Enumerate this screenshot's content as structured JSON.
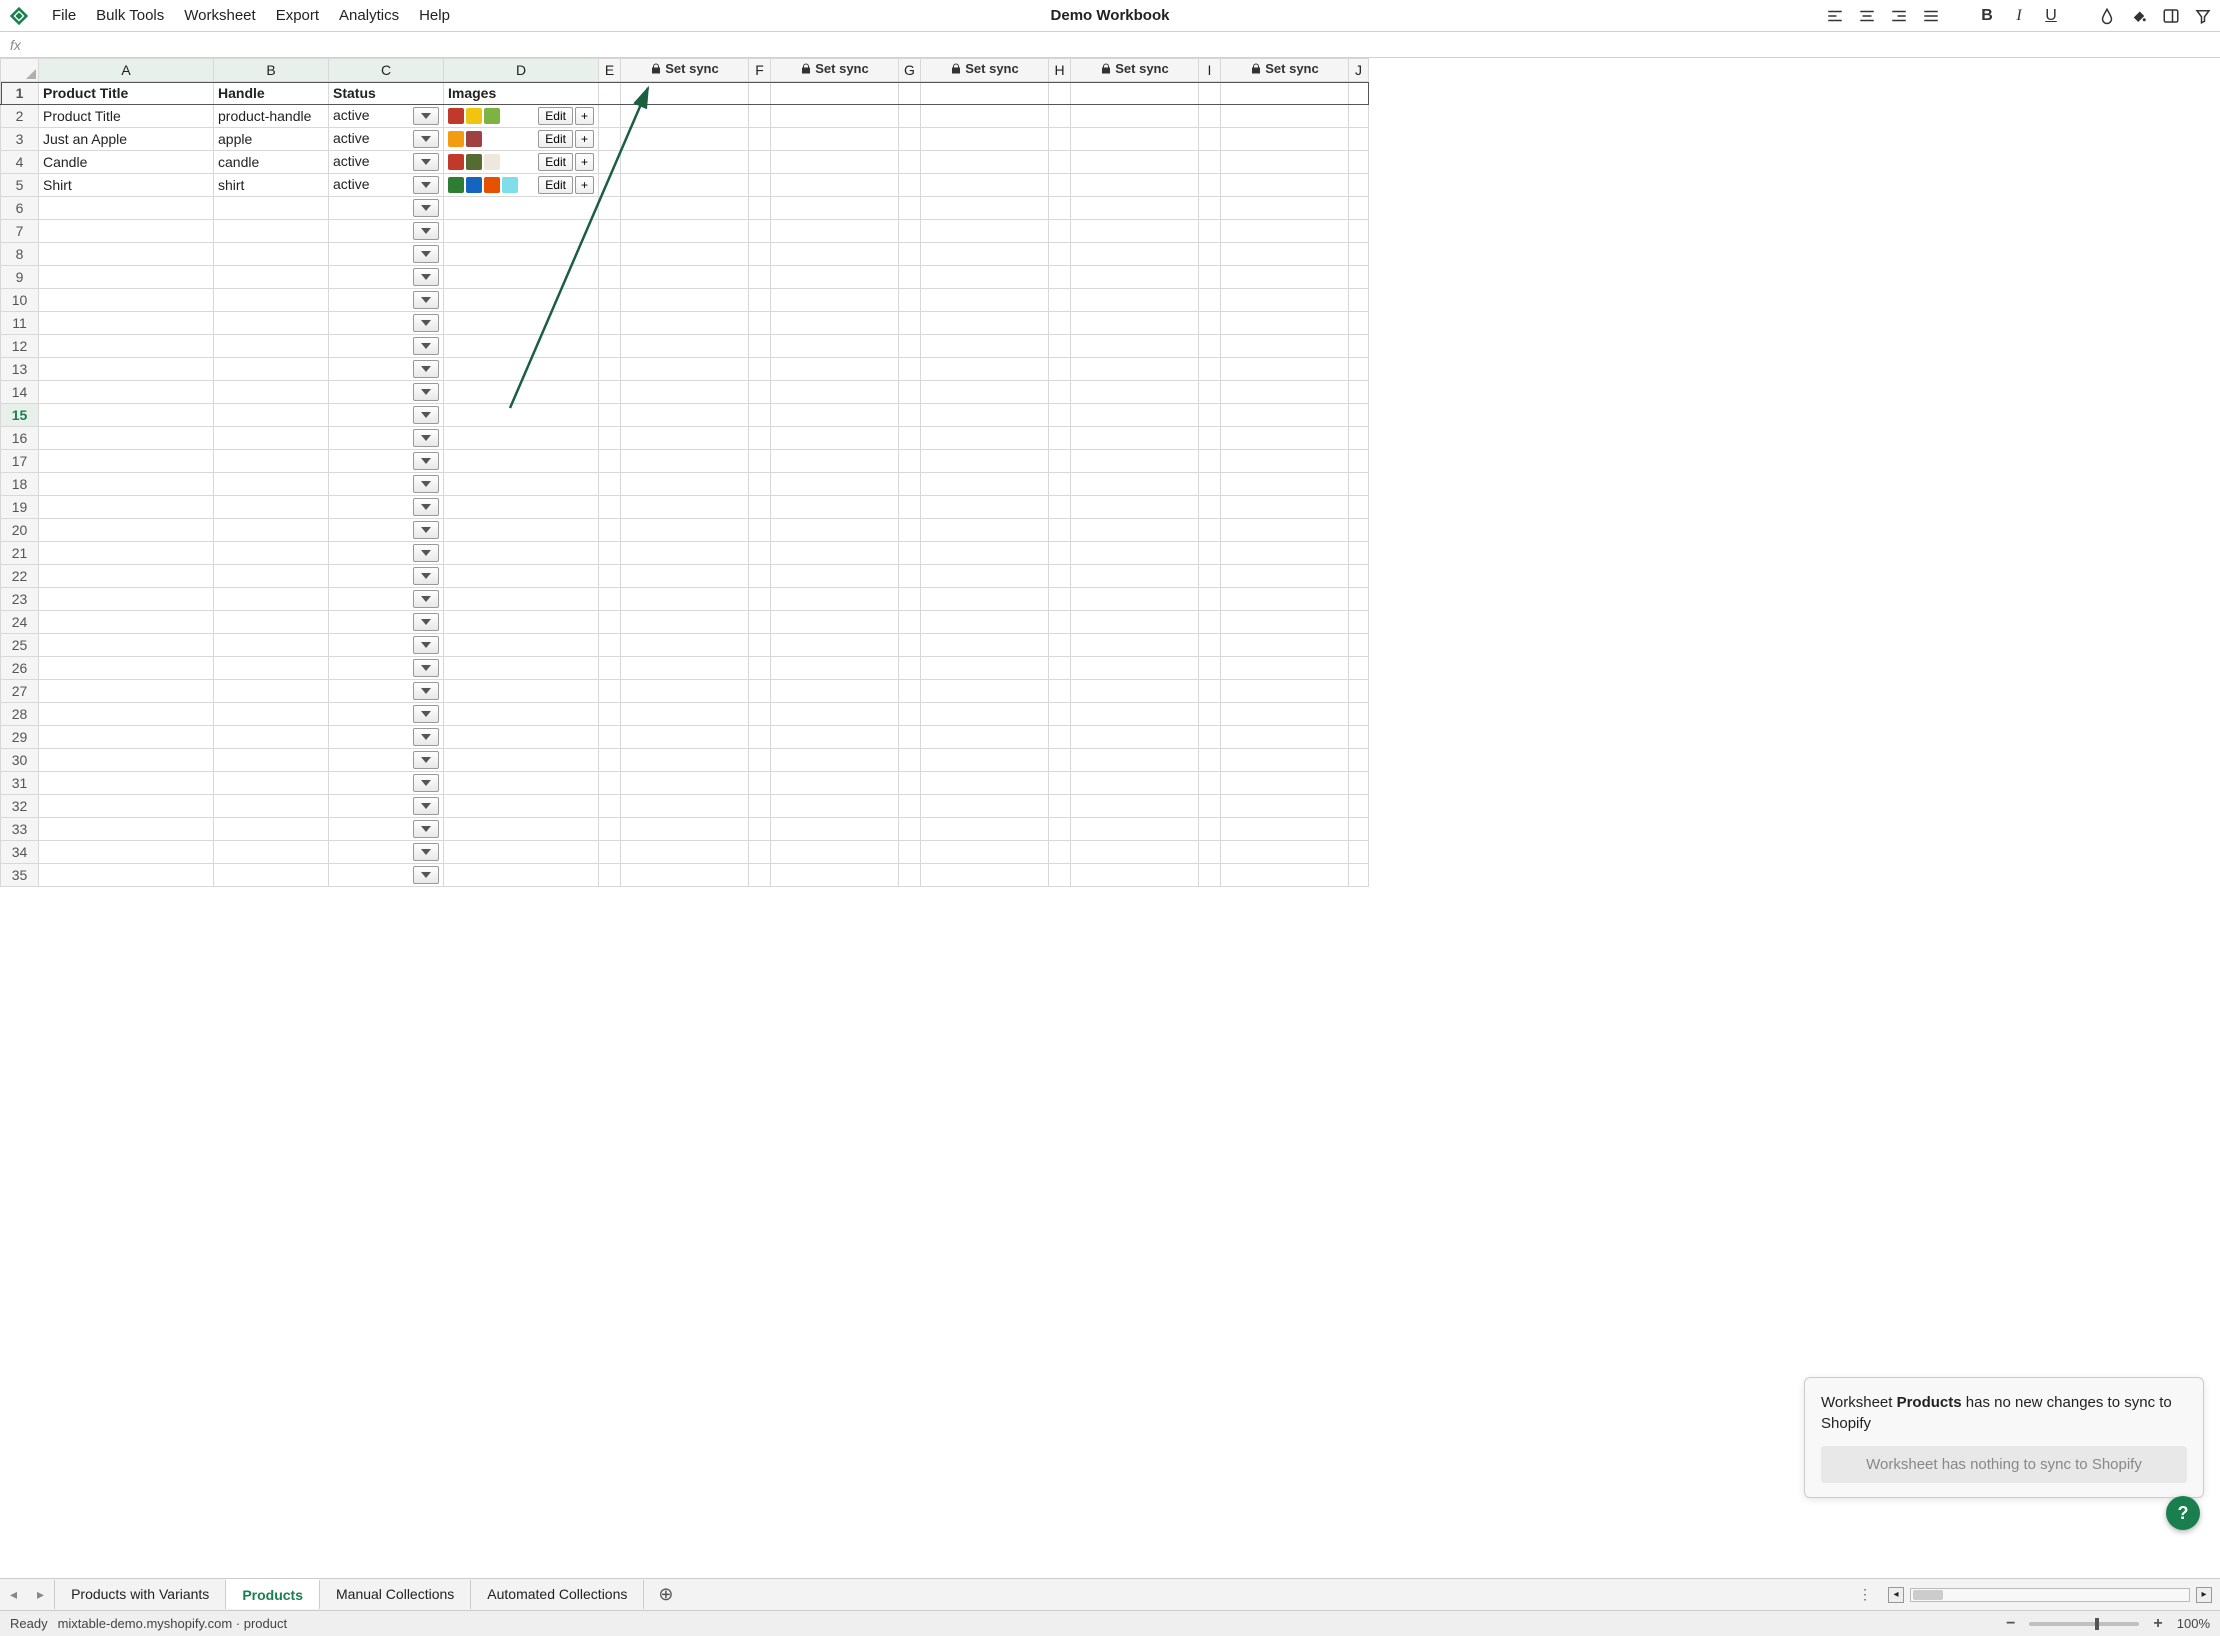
{
  "menubar": {
    "items": [
      "File",
      "Bulk Tools",
      "Worksheet",
      "Export",
      "Analytics",
      "Help"
    ],
    "workbook_title": "Demo Workbook"
  },
  "formulabar": {
    "fx": "fx"
  },
  "columns": {
    "letters": [
      "A",
      "B",
      "C",
      "D",
      "E",
      "F",
      "G",
      "H",
      "I",
      "J"
    ],
    "sync_label": "Set sync"
  },
  "headers": {
    "A": "Product Title",
    "B": "Handle",
    "C": "Status",
    "D": "Images"
  },
  "rows": [
    {
      "title": "Product Title",
      "handle": "product-handle",
      "status": "active",
      "thumbs": [
        "#c0392b",
        "#f1c40f",
        "#7cb342"
      ],
      "edit": "Edit",
      "plus": "+"
    },
    {
      "title": "Just an Apple",
      "handle": "apple",
      "status": "active",
      "thumbs": [
        "#f39c12",
        "#a04040"
      ],
      "edit": "Edit",
      "plus": "+"
    },
    {
      "title": "Candle",
      "handle": "candle",
      "status": "active",
      "thumbs": [
        "#c0392b",
        "#556b2f",
        "#eee8dc"
      ],
      "edit": "Edit",
      "plus": "+"
    },
    {
      "title": "Shirt",
      "handle": "shirt",
      "status": "active",
      "thumbs": [
        "#2e7d32",
        "#1565c0",
        "#e65100",
        "#80deea"
      ],
      "edit": "Edit",
      "plus": "+"
    }
  ],
  "total_rows": 35,
  "active_row": 15,
  "sync_panel": {
    "prefix": "Worksheet ",
    "product": "Products",
    "suffix": " has no new changes to sync to Shopify",
    "button": "Worksheet has nothing to sync to Shopify"
  },
  "tabs": {
    "items": [
      "Products with Variants",
      "Products",
      "Manual Collections",
      "Automated Collections"
    ],
    "active_index": 1
  },
  "statusbar": {
    "ready": "Ready",
    "context": "mixtable-demo.myshopify.com · product",
    "zoom": "100%"
  },
  "help_fab": "?"
}
